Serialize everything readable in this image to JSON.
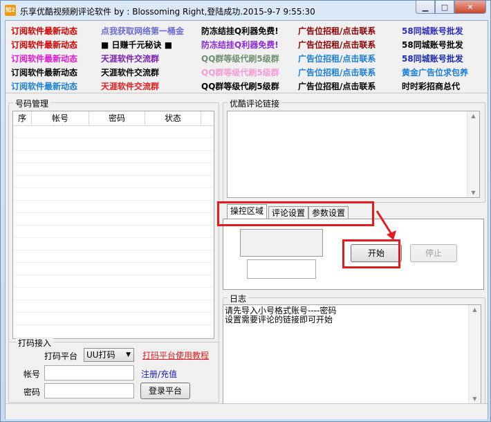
{
  "window": {
    "title": "乐享优酷视频刷评论软件      by : Blossoming     Right,登陆成功.2015-9-7 9:55:30",
    "app_icon_text": "知2",
    "minimize_glyph": "▁",
    "maximize_glyph": "□",
    "close_glyph": "✕"
  },
  "ads": [
    [
      {
        "text": "订阅软件最新动态",
        "color": "#d40000"
      },
      {
        "text": "点我获取网络第一桶金",
        "color": "#6b6bd6"
      },
      {
        "text": "防冻结挂Q利器免费!",
        "color": "#000000"
      },
      {
        "text": "广告位招租/点击联系",
        "color": "#8b0000"
      },
      {
        "text": "58同城账号批发",
        "color": "#2c2cc4"
      }
    ],
    [
      {
        "text": "订阅软件最新动态",
        "color": "#d40000"
      },
      {
        "text": "■ 日赚千元秘诀 ■",
        "color": "#000000"
      },
      {
        "text": "防冻结挂Q利器免费!",
        "color": "#8b2bd8"
      },
      {
        "text": "广告位招租/点击联系",
        "color": "#8b0000"
      },
      {
        "text": "58同城账号批发",
        "color": "#000000"
      }
    ],
    [
      {
        "text": "订阅软件最新动态",
        "color": "#e21ad0"
      },
      {
        "text": "天涯软件交流群",
        "color": "#7a1fb0"
      },
      {
        "text": "QQ群等级代刷5级群",
        "color": "#6e8f6e"
      },
      {
        "text": "广告位招租/点击联系",
        "color": "#1a7fd6"
      },
      {
        "text": "58同城账号批发",
        "color": "#1a2bb4"
      }
    ],
    [
      {
        "text": "订阅软件最新动态",
        "color": "#000000"
      },
      {
        "text": "天涯软件交流群",
        "color": "#000000"
      },
      {
        "text": "QQ群等级代刷5级群",
        "color": "#f59bd6"
      },
      {
        "text": "广告位招租/点击联系",
        "color": "#1a7fd6"
      },
      {
        "text": "黄金广告位求包养",
        "color": "#1a7fd6"
      }
    ],
    [
      {
        "text": "订阅软件最新动态",
        "color": "#1a7fd6"
      },
      {
        "text": "天涯软件交流群",
        "color": "#e21c1c"
      },
      {
        "text": "QQ群等级代刷5级群",
        "color": "#000000"
      },
      {
        "text": "广告位招租/点击联系",
        "color": "#000000"
      },
      {
        "text": "时时彩招商总代",
        "color": "#000000"
      }
    ]
  ],
  "accounts": {
    "group_label": "号码管理",
    "columns": [
      "序",
      "帐号",
      "密码",
      "状态"
    ]
  },
  "comment_link": {
    "group_label": "优酷评论链接"
  },
  "tabs": {
    "items": [
      "操控区域",
      "评论设置",
      "参数设置"
    ],
    "start_label": "开始",
    "stop_label": "停止"
  },
  "log": {
    "group_label": "日志",
    "lines": [
      "请先导入小号格式账号----密码",
      "设置需要评论的链接即可开始"
    ]
  },
  "captcha": {
    "group_label": "打码接入",
    "platform_label": "打码平台",
    "platform_selected": "UU打码",
    "tutorial_link": "打码平台使用教程",
    "account_label": "帐号",
    "password_label": "密码",
    "register_link": "注册/充值",
    "login_button": "登录平台"
  },
  "colors": {
    "highlight": "#e21c1c"
  }
}
